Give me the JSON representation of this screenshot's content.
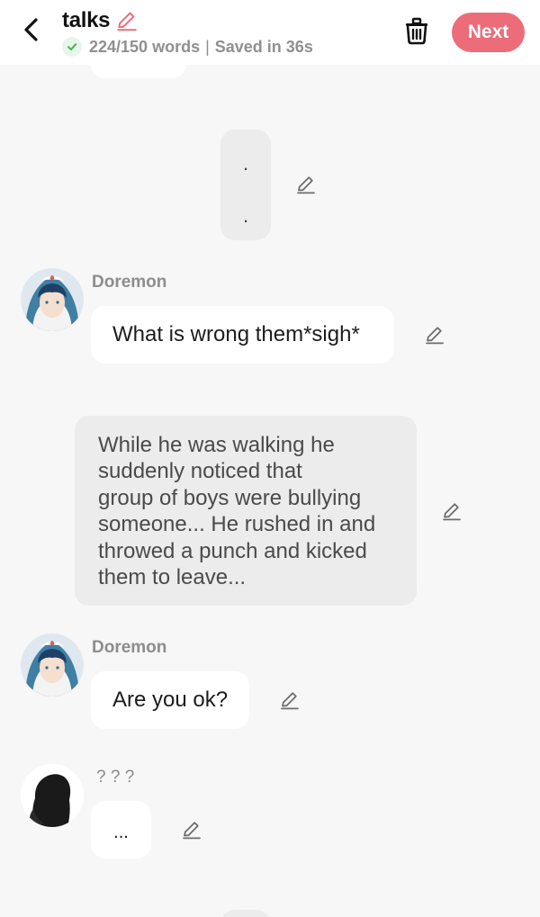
{
  "header": {
    "title": "talks",
    "word_count": "224/150 words",
    "separator": "|",
    "saved": "Saved in 36s",
    "next_label": "Next"
  },
  "messages": [
    {
      "type": "narration",
      "text": "."
    },
    {
      "type": "narration",
      "text": "."
    },
    {
      "type": "dialogue",
      "character": "Doremon",
      "text": "What is wrong them*sigh*"
    },
    {
      "type": "narration",
      "text": "While he was walking he\nsuddenly noticed that\ngroup of boys were bullying\nsomeone... He rushed in and\nthrowed a punch and kicked\nthem to leave..."
    },
    {
      "type": "dialogue",
      "character": "Doremon",
      "text": "Are you ok?"
    },
    {
      "type": "dialogue",
      "character": "? ? ?",
      "text": "..."
    }
  ],
  "colors": {
    "accent": "#ec6c79",
    "background": "#f7f7f7",
    "bubble": "#ffffff",
    "narration_bubble": "#ececec",
    "saved_check": "#4caf50"
  }
}
